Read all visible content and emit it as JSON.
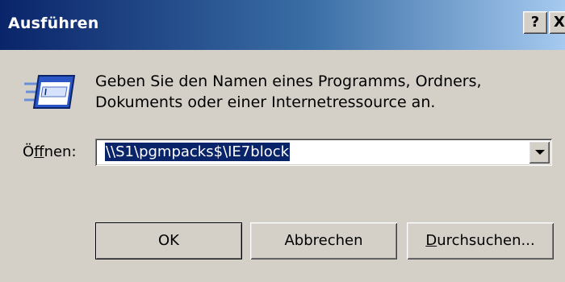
{
  "window": {
    "title": "Ausführen",
    "help_label": "?",
    "close_label": "X"
  },
  "description": {
    "line1": "Geben Sie den Namen eines Programms, Ordners,",
    "line2": "Dokuments oder einer Internetressource an."
  },
  "open_field": {
    "label_prefix": "Ö",
    "label_mnemonic": "f",
    "label_suffix": "fnen:",
    "value": "\\\\S1\\pgmpacks$\\IE7block"
  },
  "buttons": {
    "ok": "OK",
    "cancel": "Abbrechen",
    "browse_mnemonic": "D",
    "browse_rest": "urchsuchen..."
  },
  "icons": {
    "run": "run-dialog-icon",
    "dropdown": "chevron-down-icon"
  }
}
